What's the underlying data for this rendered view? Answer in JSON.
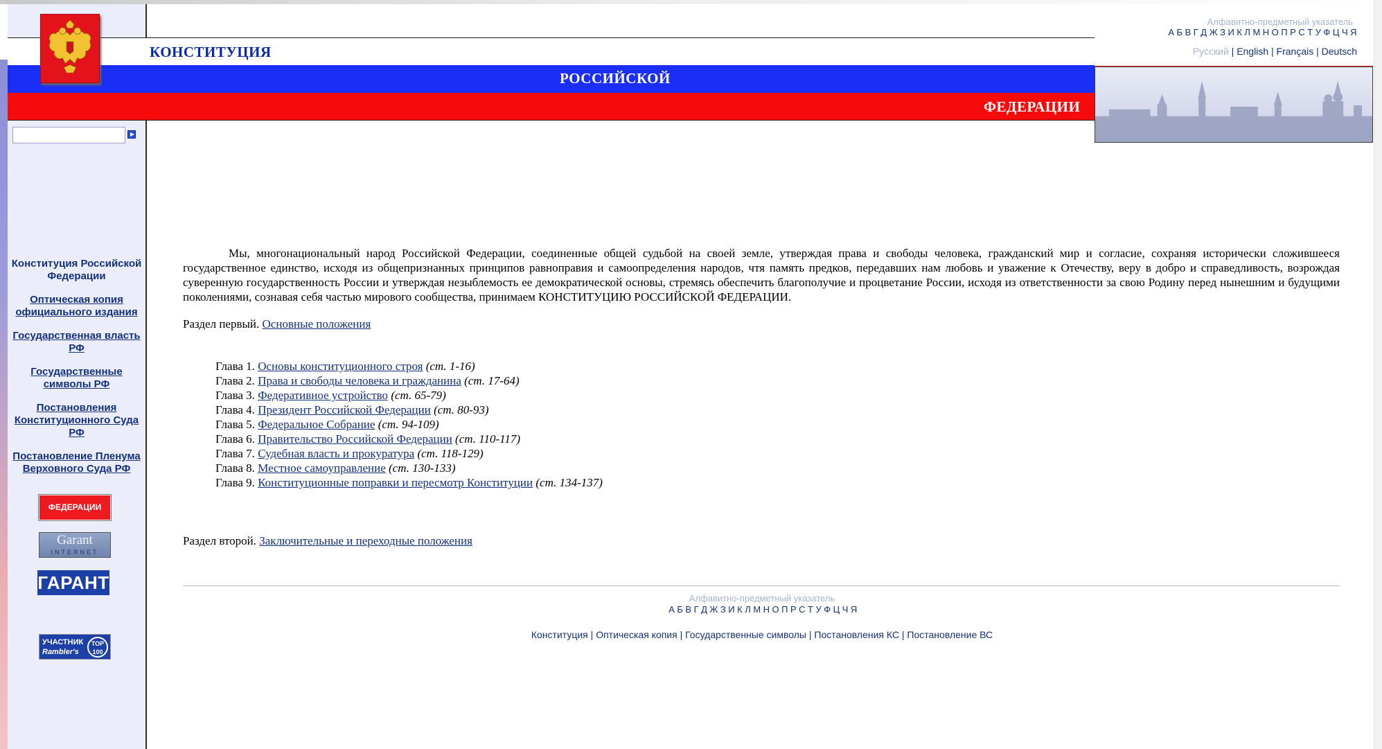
{
  "header": {
    "word1": "КОНСТИТУЦИЯ",
    "word2": "РОССИЙСКОЙ",
    "word3": "ФЕДЕРАЦИИ"
  },
  "index": {
    "title": "Алфавитно-предметный указатель",
    "letters": [
      "А",
      "Б",
      "В",
      "Г",
      "Д",
      "Ж",
      "З",
      "И",
      "К",
      "Л",
      "М",
      "Н",
      "О",
      "П",
      "Р",
      "С",
      "Т",
      "У",
      "Ф",
      "Ц",
      "Ч",
      "Я"
    ]
  },
  "languages": {
    "ru": "Русский",
    "en": "English",
    "fr": "Français",
    "de": "Deutsch",
    "sep": "|"
  },
  "sidebar": {
    "search_value": "",
    "nav": [
      "Конституция Российской Федерации",
      "Оптическая копия официального издания",
      "Государственная власть РФ",
      "Государственные символы РФ",
      "Постановления Конституционного Суда РФ",
      "Постановление Пленума Верховного Суда РФ"
    ],
    "badges": {
      "federacii": "ФЕДЕРАЦИИ",
      "garant_net_1": "Garant",
      "garant_net_2": "INTERNET",
      "garant": "ГАРАНТ",
      "rambler_1": "УЧАСТНИК",
      "rambler_2": "Rambler's",
      "rambler_3": "TOP 100"
    }
  },
  "main": {
    "preamble": "Мы, многонациональный народ Российской Федерации, соединенные общей судьбой на своей земле, утверждая права и свободы человека, гражданский мир и согласие, сохраняя исторически сложившееся государственное единство, исходя из общепризнанных принципов равноправия и самоопределения народов, чтя память предков, передавших нам любовь и уважение к Отечеству, веру в добро и справедливость, возрождая суверенную государственность России и утверждая незыблемость ее демократической основы, стремясь обеспечить благополучие и процветание России, исходя из ответственности за свою Родину перед нынешним и будущими поколениями, сознавая себя частью мирового сообщества, принимаем КОНСТИТУЦИЮ РОССИЙСКОЙ ФЕДЕРАЦИИ.",
    "section1_prefix": "Раздел первый.",
    "section1_link": "Основные положения",
    "chapters": [
      {
        "num": "Глава 1.",
        "title": "Основы конституционного строя",
        "range": "(ст. 1-16)"
      },
      {
        "num": "Глава 2.",
        "title": "Права и свободы человека и гражданина",
        "range": "(ст. 17-64)"
      },
      {
        "num": "Глава 3.",
        "title": "Федеративное устройство",
        "range": "(ст. 65-79)"
      },
      {
        "num": "Глава 4.",
        "title": "Президент Российской Федерации",
        "range": "(ст. 80-93)"
      },
      {
        "num": "Глава 5.",
        "title": "Федеральное Собрание",
        "range": "(ст. 94-109)"
      },
      {
        "num": "Глава 6.",
        "title": "Правительство Российской Федерации",
        "range": "(ст. 110-117)"
      },
      {
        "num": "Глава 7.",
        "title": "Судебная власть и прокуратура",
        "range": "(ст. 118-129)"
      },
      {
        "num": "Глава 8.",
        "title": "Местное самоуправление",
        "range": "(ст. 130-133)"
      },
      {
        "num": "Глава 9.",
        "title": "Конституционные поправки и пересмотр Конституции",
        "range": "(ст. 134-137)"
      }
    ],
    "section2_prefix": "Раздел второй.",
    "section2_link": "Заключительные и переходные положения"
  },
  "footer": {
    "index_title": "Алфавитно-предметный указатель",
    "links": [
      "Конституция",
      "Оптическая копия",
      "Государственные символы",
      "Постановления КС",
      "Постановление ВС"
    ],
    "sep": "|"
  },
  "colors": {
    "flag_blue": "#1a2ef5",
    "flag_red": "#f70a0a",
    "link": "#14317d",
    "muted": "#a9b4d3",
    "sidebar_bg": "#ecedfb"
  }
}
